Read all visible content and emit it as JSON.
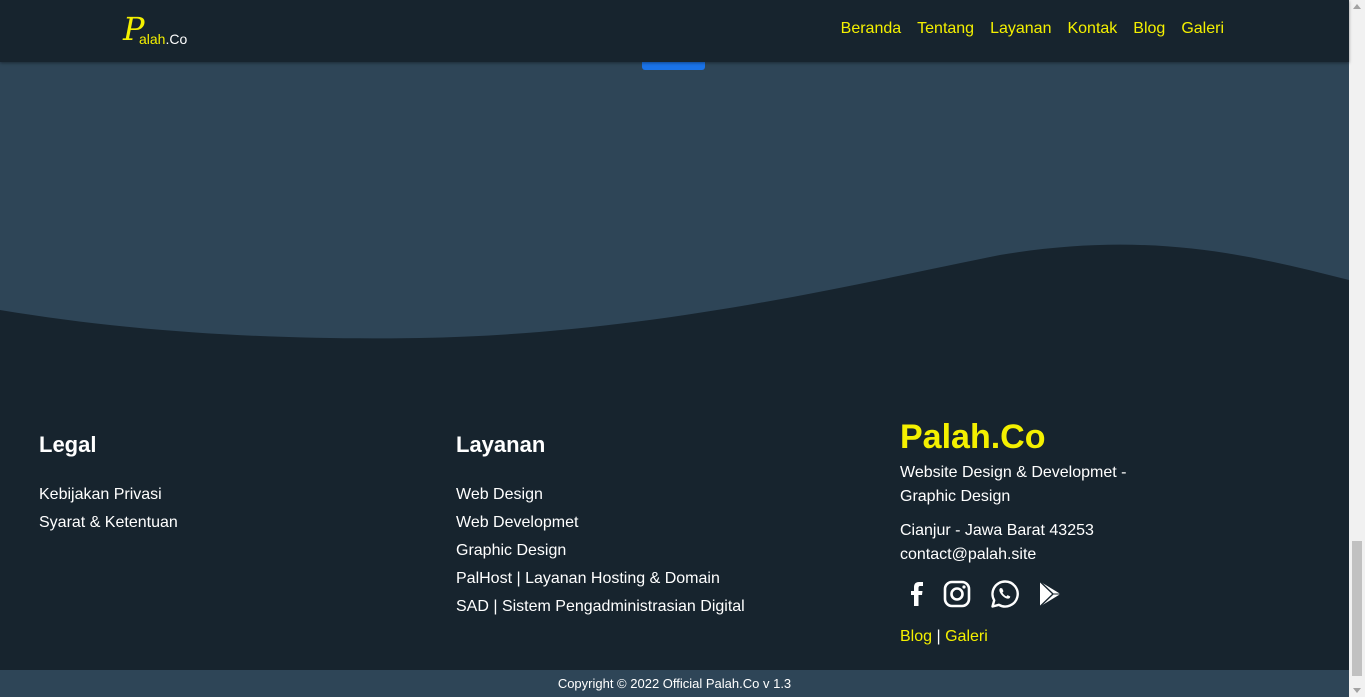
{
  "nav": {
    "logo_letter": "P",
    "logo_text_main": "alah",
    "logo_text_suffix": ".Co",
    "links": [
      "Beranda",
      "Tentang",
      "Layanan",
      "Kontak",
      "Blog",
      "Galeri"
    ]
  },
  "footer": {
    "legal": {
      "heading": "Legal",
      "links": [
        "Kebijakan Privasi",
        "Syarat & Ketentuan"
      ]
    },
    "layanan": {
      "heading": "Layanan",
      "links": [
        "Web Design",
        "Web Developmet",
        "Graphic Design",
        "PalHost | Layanan Hosting & Domain",
        "SAD | Sistem Pengadministrasian Digital"
      ]
    },
    "brand": {
      "name": "Palah.Co",
      "tagline_line1": "Website Design & Developmet -",
      "tagline_line2": "Graphic Design",
      "address": "Cianjur - Jawa Barat 43253",
      "email": "contact@palah.site",
      "social_icons": [
        "facebook-icon",
        "instagram-icon",
        "whatsapp-icon",
        "google-play-icon"
      ],
      "bottom_link_blog": "Blog",
      "bottom_link_sep": "|",
      "bottom_link_galeri": "Galeri"
    }
  },
  "copyright": "Copyright © 2022 Official Palah.Co v 1.3",
  "colors": {
    "accent_yellow": "#f4f000",
    "dark_bg": "#17242e",
    "hero_bg": "#2e4557",
    "button_blue": "#1a73e8"
  }
}
